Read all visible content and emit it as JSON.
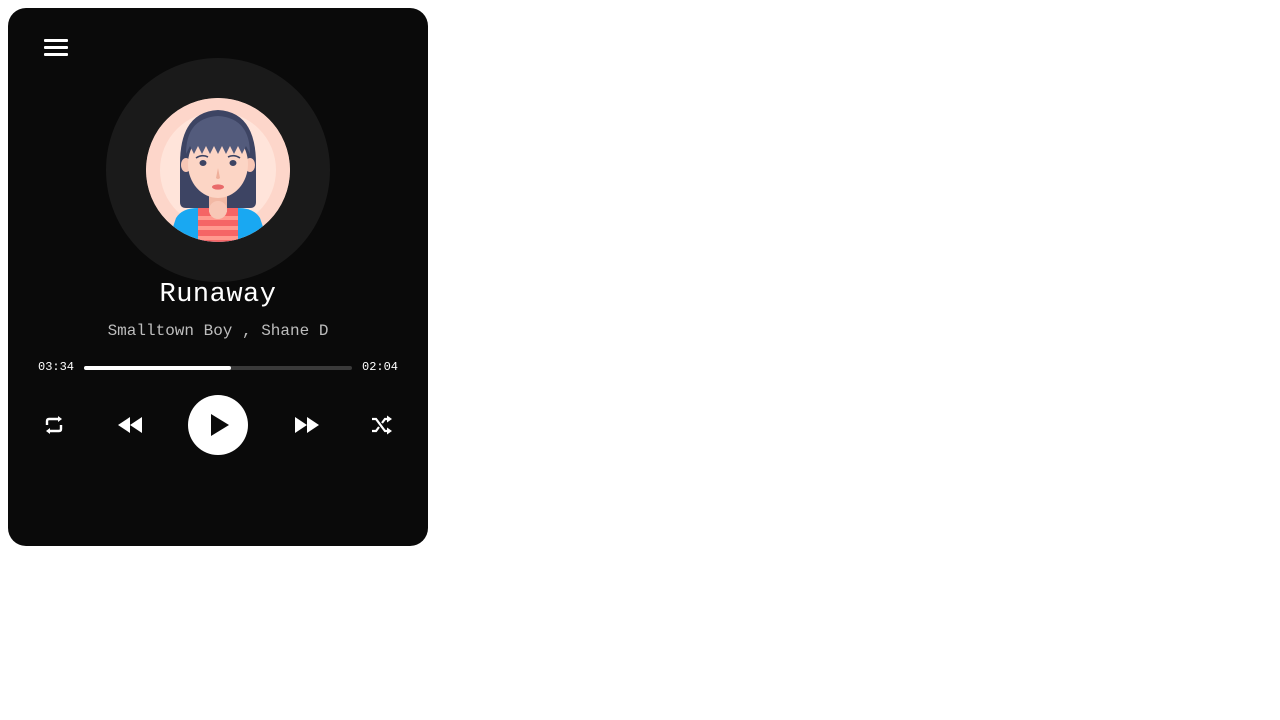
{
  "header": {
    "menu_icon": "hamburger-menu-icon"
  },
  "album": {
    "artwork": "female-avatar-illustration"
  },
  "track": {
    "title": "Runaway",
    "artists": "Smalltown Boy , Shane D"
  },
  "progress": {
    "elapsed": "03:34",
    "remaining": "02:04",
    "fraction": 0.55
  },
  "controls": {
    "repeat_icon": "repeat-icon",
    "previous_icon": "rewind-icon",
    "play_icon": "play-icon",
    "next_icon": "fast-forward-icon",
    "shuffle_icon": "shuffle-icon"
  },
  "colors": {
    "background": "#0a0a0a",
    "disc": "#1a1a1a",
    "accent": "#ffffff",
    "secondary_text": "#bdbdbd",
    "track": "#3a3a3a"
  }
}
